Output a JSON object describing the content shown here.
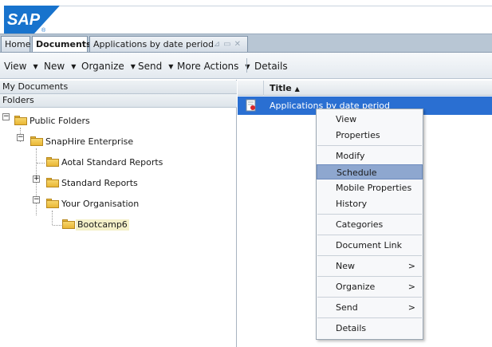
{
  "brand": {
    "logo_text": "SAP",
    "logo_color": "#1873cd"
  },
  "tabs": [
    {
      "label": "Home"
    },
    {
      "label": "Documents"
    },
    {
      "label": "Applications by date period"
    }
  ],
  "toolbar": {
    "view": "View",
    "new": "New",
    "organize": "Organize",
    "send": "Send",
    "more_actions": "More Actions",
    "details": "Details"
  },
  "left_panel": {
    "my_documents": "My Documents",
    "folders": "Folders",
    "tree": [
      {
        "label": "Public Folders"
      },
      {
        "label": "SnapHire Enterprise"
      },
      {
        "label": "Aotal Standard Reports"
      },
      {
        "label": "Standard Reports"
      },
      {
        "label": "Your Organisation"
      },
      {
        "label": "Bootcamp6"
      }
    ]
  },
  "list": {
    "title_header": "Title",
    "sort_indicator": "▲",
    "rows": [
      {
        "title": "Applications by date period"
      }
    ]
  },
  "context_menu": {
    "items": [
      {
        "label": "View"
      },
      {
        "label": "Properties"
      },
      {
        "label": "Modify"
      },
      {
        "label": "Schedule"
      },
      {
        "label": "Mobile Properties"
      },
      {
        "label": "History"
      },
      {
        "label": "Categories"
      },
      {
        "label": "Document Link"
      },
      {
        "label": "New",
        "submenu": ">"
      },
      {
        "label": "Organize",
        "submenu": ">"
      },
      {
        "label": "Send",
        "submenu": ">"
      },
      {
        "label": "Details"
      }
    ],
    "highlighted": "Schedule",
    "highlight_color": "#8ea7cf"
  },
  "colors": {
    "selection": "#2a6fd2",
    "folder": "#e9b735"
  }
}
